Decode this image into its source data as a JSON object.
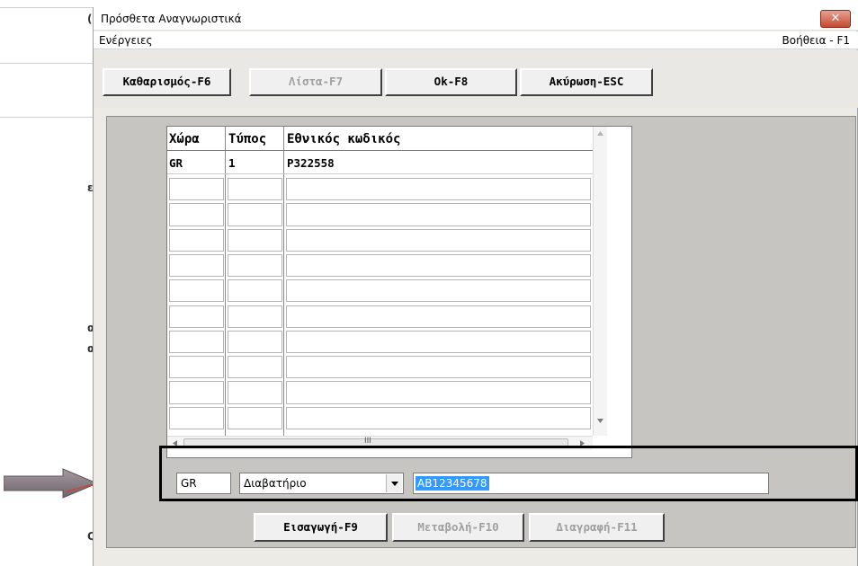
{
  "window": {
    "title": "Πρόσθετα Αναγνωριστικά",
    "close_symbol": "✕"
  },
  "menu": {
    "actions": "Ενέργειες",
    "help": "Βοήθεια - F1"
  },
  "toolbar": {
    "clear_label": "Καθαρισμός-F6",
    "list_label": "Λίστα-F7",
    "ok_label": "Ok-F8",
    "cancel_label": "Ακύρωση-ESC"
  },
  "table": {
    "columns": [
      "Χώρα",
      "Τύπος",
      "Εθνικός κωδικός"
    ],
    "rows": [
      [
        "GR",
        "1",
        "P322558"
      ]
    ],
    "hscroll_glyph": "III"
  },
  "entry": {
    "country": "GR",
    "type": "Διαβατήριο",
    "code": "AB12345678"
  },
  "bottom_buttons": {
    "insert_label": "Εισαγωγή-F9",
    "modify_label": "Μεταβολή-F10",
    "delete_label": "Διαγραφή-F11"
  },
  "background_page": {
    "chars": [
      "(",
      "ε",
      "α",
      "α",
      "Q"
    ]
  },
  "colors": {
    "selection": "#3399ff",
    "arrow": "#8a7f86",
    "close_button": "#c44a30"
  }
}
